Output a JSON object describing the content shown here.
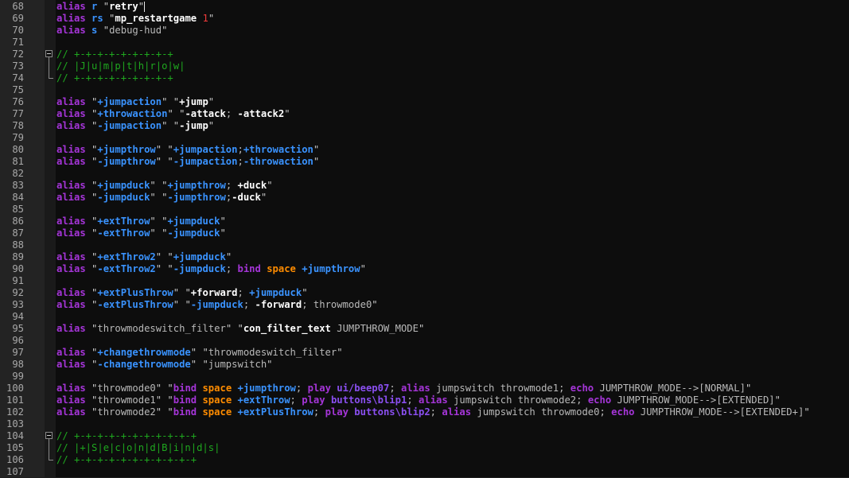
{
  "editor": {
    "colors": {
      "alias": "#a535d8",
      "plus_command": "#3a93ff",
      "comment": "#1fa81f",
      "number": "#f03a3a",
      "orange_keyword": "#ff8c00",
      "line_number": "#a8a8a8",
      "background": "#0d0d0d"
    }
  },
  "lines": [
    {
      "n": "68",
      "tokens": [
        [
          "alias",
          "t-alias"
        ],
        [
          " ",
          "t-name"
        ],
        [
          "r",
          "t-plus"
        ],
        [
          " \"",
          "t-quote"
        ],
        [
          "retry",
          "t-white"
        ],
        [
          "\"",
          "t-quote"
        ]
      ],
      "caret": true
    },
    {
      "n": "69",
      "tokens": [
        [
          "alias",
          "t-alias"
        ],
        [
          " ",
          "t-name"
        ],
        [
          "rs",
          "t-plus"
        ],
        [
          " \"",
          "t-quote"
        ],
        [
          "mp_restartgame",
          "t-white"
        ],
        [
          " ",
          "t-quote"
        ],
        [
          "1",
          "t-num"
        ],
        [
          "\"",
          "t-quote"
        ]
      ]
    },
    {
      "n": "70",
      "tokens": [
        [
          "alias",
          "t-alias"
        ],
        [
          " ",
          "t-name"
        ],
        [
          "s",
          "t-plus"
        ],
        [
          " \"",
          "t-quote"
        ],
        [
          "debug-hud",
          "t-dim"
        ],
        [
          "\"",
          "t-quote"
        ]
      ]
    },
    {
      "n": "71",
      "tokens": []
    },
    {
      "n": "72",
      "tokens": [
        [
          "// +-+-+-+-+-+-+-+-+",
          "t-comment"
        ]
      ],
      "fold": "start"
    },
    {
      "n": "73",
      "tokens": [
        [
          "// |J|u|m|p|t|h|r|o|w|",
          "t-comment"
        ]
      ]
    },
    {
      "n": "74",
      "tokens": [
        [
          "// +-+-+-+-+-+-+-+-+",
          "t-comment"
        ]
      ],
      "fold": "end"
    },
    {
      "n": "75",
      "tokens": []
    },
    {
      "n": "76",
      "tokens": [
        [
          "alias",
          "t-alias"
        ],
        [
          " \"",
          "t-quote"
        ],
        [
          "+jumpaction",
          "t-plus"
        ],
        [
          "\" \"",
          "t-quote"
        ],
        [
          "+jump",
          "t-white"
        ],
        [
          "\"",
          "t-quote"
        ]
      ]
    },
    {
      "n": "77",
      "tokens": [
        [
          "alias",
          "t-alias"
        ],
        [
          " \"",
          "t-quote"
        ],
        [
          "+throwaction",
          "t-plus"
        ],
        [
          "\" \"",
          "t-quote"
        ],
        [
          "-attack",
          "t-white"
        ],
        [
          "; ",
          "t-dim"
        ],
        [
          "-attack2",
          "t-white"
        ],
        [
          "\"",
          "t-quote"
        ]
      ]
    },
    {
      "n": "78",
      "tokens": [
        [
          "alias",
          "t-alias"
        ],
        [
          " \"",
          "t-quote"
        ],
        [
          "-jumpaction",
          "t-plus"
        ],
        [
          "\" \"",
          "t-quote"
        ],
        [
          "-jump",
          "t-white"
        ],
        [
          "\"",
          "t-quote"
        ]
      ]
    },
    {
      "n": "79",
      "tokens": []
    },
    {
      "n": "80",
      "tokens": [
        [
          "alias",
          "t-alias"
        ],
        [
          " \"",
          "t-quote"
        ],
        [
          "+jumpthrow",
          "t-plus"
        ],
        [
          "\" \"",
          "t-quote"
        ],
        [
          "+jumpaction",
          "t-plus"
        ],
        [
          ";",
          "t-dim"
        ],
        [
          "+throwaction",
          "t-plus"
        ],
        [
          "\"",
          "t-quote"
        ]
      ]
    },
    {
      "n": "81",
      "tokens": [
        [
          "alias",
          "t-alias"
        ],
        [
          " \"",
          "t-quote"
        ],
        [
          "-jumpthrow",
          "t-plus"
        ],
        [
          "\" \"",
          "t-quote"
        ],
        [
          "-jumpaction",
          "t-plus"
        ],
        [
          ";",
          "t-dim"
        ],
        [
          "-throwaction",
          "t-plus"
        ],
        [
          "\"",
          "t-quote"
        ]
      ]
    },
    {
      "n": "82",
      "tokens": []
    },
    {
      "n": "83",
      "tokens": [
        [
          "alias",
          "t-alias"
        ],
        [
          " \"",
          "t-quote"
        ],
        [
          "+jumpduck",
          "t-plus"
        ],
        [
          "\" \"",
          "t-quote"
        ],
        [
          "+jumpthrow",
          "t-plus"
        ],
        [
          "; ",
          "t-dim"
        ],
        [
          "+duck",
          "t-white"
        ],
        [
          "\"",
          "t-quote"
        ]
      ]
    },
    {
      "n": "84",
      "tokens": [
        [
          "alias",
          "t-alias"
        ],
        [
          " \"",
          "t-quote"
        ],
        [
          "-jumpduck",
          "t-plus"
        ],
        [
          "\" \"",
          "t-quote"
        ],
        [
          "-jumpthrow",
          "t-plus"
        ],
        [
          ";",
          "t-dim"
        ],
        [
          "-duck",
          "t-white"
        ],
        [
          "\"",
          "t-quote"
        ]
      ]
    },
    {
      "n": "85",
      "tokens": []
    },
    {
      "n": "86",
      "tokens": [
        [
          "alias",
          "t-alias"
        ],
        [
          " \"",
          "t-quote"
        ],
        [
          "+extThrow",
          "t-plus"
        ],
        [
          "\" \"",
          "t-quote"
        ],
        [
          "+jumpduck",
          "t-plus"
        ],
        [
          "\"",
          "t-quote"
        ]
      ]
    },
    {
      "n": "87",
      "tokens": [
        [
          "alias",
          "t-alias"
        ],
        [
          " \"",
          "t-quote"
        ],
        [
          "-extThrow",
          "t-plus"
        ],
        [
          "\" \"",
          "t-quote"
        ],
        [
          "-jumpduck",
          "t-plus"
        ],
        [
          "\"",
          "t-quote"
        ]
      ]
    },
    {
      "n": "88",
      "tokens": []
    },
    {
      "n": "89",
      "tokens": [
        [
          "alias",
          "t-alias"
        ],
        [
          " \"",
          "t-quote"
        ],
        [
          "+extThrow2",
          "t-plus"
        ],
        [
          "\" \"",
          "t-quote"
        ],
        [
          "+jumpduck",
          "t-plus"
        ],
        [
          "\"",
          "t-quote"
        ]
      ]
    },
    {
      "n": "90",
      "tokens": [
        [
          "alias",
          "t-alias"
        ],
        [
          " \"",
          "t-quote"
        ],
        [
          "-extThrow2",
          "t-plus"
        ],
        [
          "\" \"",
          "t-quote"
        ],
        [
          "-jumpduck",
          "t-plus"
        ],
        [
          "; ",
          "t-dim"
        ],
        [
          "bind",
          "t-bind"
        ],
        [
          " ",
          "t-dim"
        ],
        [
          "space",
          "t-orange"
        ],
        [
          " ",
          "t-dim"
        ],
        [
          "+jumpthrow",
          "t-plus"
        ],
        [
          "\"",
          "t-quote"
        ]
      ]
    },
    {
      "n": "91",
      "tokens": []
    },
    {
      "n": "92",
      "tokens": [
        [
          "alias",
          "t-alias"
        ],
        [
          " \"",
          "t-quote"
        ],
        [
          "+extPlusThrow",
          "t-plus"
        ],
        [
          "\" \"",
          "t-quote"
        ],
        [
          "+forward",
          "t-white"
        ],
        [
          "; ",
          "t-dim"
        ],
        [
          "+jumpduck",
          "t-plus"
        ],
        [
          "\"",
          "t-quote"
        ]
      ]
    },
    {
      "n": "93",
      "tokens": [
        [
          "alias",
          "t-alias"
        ],
        [
          " \"",
          "t-quote"
        ],
        [
          "-extPlusThrow",
          "t-plus"
        ],
        [
          "\" \"",
          "t-quote"
        ],
        [
          "-jumpduck",
          "t-plus"
        ],
        [
          "; ",
          "t-dim"
        ],
        [
          "-forward",
          "t-white"
        ],
        [
          "; ",
          "t-dim"
        ],
        [
          "throwmode0",
          "t-dim"
        ],
        [
          "\"",
          "t-quote"
        ]
      ]
    },
    {
      "n": "94",
      "tokens": []
    },
    {
      "n": "95",
      "tokens": [
        [
          "alias",
          "t-alias"
        ],
        [
          " \"",
          "t-quote"
        ],
        [
          "throwmodeswitch_filter",
          "t-dim"
        ],
        [
          "\" \"",
          "t-quote"
        ],
        [
          "con_filter_text",
          "t-white"
        ],
        [
          " ",
          "t-dim"
        ],
        [
          "JUMPTHROW_MODE",
          "t-dim"
        ],
        [
          "\"",
          "t-quote"
        ]
      ]
    },
    {
      "n": "96",
      "tokens": []
    },
    {
      "n": "97",
      "tokens": [
        [
          "alias",
          "t-alias"
        ],
        [
          " \"",
          "t-quote"
        ],
        [
          "+changethrowmode",
          "t-plus"
        ],
        [
          "\" \"",
          "t-quote"
        ],
        [
          "throwmodeswitch_filter",
          "t-dim"
        ],
        [
          "\"",
          "t-quote"
        ]
      ]
    },
    {
      "n": "98",
      "tokens": [
        [
          "alias",
          "t-alias"
        ],
        [
          " \"",
          "t-quote"
        ],
        [
          "-changethrowmode",
          "t-plus"
        ],
        [
          "\" \"",
          "t-quote"
        ],
        [
          "jumpswitch",
          "t-dim"
        ],
        [
          "\"",
          "t-quote"
        ]
      ]
    },
    {
      "n": "99",
      "tokens": []
    },
    {
      "n": "100",
      "tokens": [
        [
          "alias",
          "t-alias"
        ],
        [
          " \"",
          "t-quote"
        ],
        [
          "throwmode0",
          "t-dim"
        ],
        [
          "\" \"",
          "t-quote"
        ],
        [
          "bind",
          "t-bind"
        ],
        [
          " ",
          "t-dim"
        ],
        [
          "space",
          "t-orange"
        ],
        [
          " ",
          "t-dim"
        ],
        [
          "+jumpthrow",
          "t-plus"
        ],
        [
          "; ",
          "t-dim"
        ],
        [
          "play",
          "t-play"
        ],
        [
          " ",
          "t-dim"
        ],
        [
          "ui/beep07",
          "t-path"
        ],
        [
          "; ",
          "t-dim"
        ],
        [
          "alias",
          "t-alias"
        ],
        [
          " jumpswitch throwmode1; ",
          "t-dim"
        ],
        [
          "echo",
          "t-echo"
        ],
        [
          " JUMPTHROW_MODE-->[NORMAL]",
          "t-dim"
        ],
        [
          "\"",
          "t-quote"
        ]
      ]
    },
    {
      "n": "101",
      "tokens": [
        [
          "alias",
          "t-alias"
        ],
        [
          " \"",
          "t-quote"
        ],
        [
          "throwmode1",
          "t-dim"
        ],
        [
          "\" \"",
          "t-quote"
        ],
        [
          "bind",
          "t-bind"
        ],
        [
          " ",
          "t-dim"
        ],
        [
          "space",
          "t-orange"
        ],
        [
          " ",
          "t-dim"
        ],
        [
          "+extThrow",
          "t-plus"
        ],
        [
          "; ",
          "t-dim"
        ],
        [
          "play",
          "t-play"
        ],
        [
          " ",
          "t-dim"
        ],
        [
          "buttons\\blip1",
          "t-path"
        ],
        [
          "; ",
          "t-dim"
        ],
        [
          "alias",
          "t-alias"
        ],
        [
          " jumpswitch throwmode2; ",
          "t-dim"
        ],
        [
          "echo",
          "t-echo"
        ],
        [
          " JUMPTHROW_MODE-->[EXTENDED]",
          "t-dim"
        ],
        [
          "\"",
          "t-quote"
        ]
      ]
    },
    {
      "n": "102",
      "tokens": [
        [
          "alias",
          "t-alias"
        ],
        [
          " \"",
          "t-quote"
        ],
        [
          "throwmode2",
          "t-dim"
        ],
        [
          "\" \"",
          "t-quote"
        ],
        [
          "bind",
          "t-bind"
        ],
        [
          " ",
          "t-dim"
        ],
        [
          "space",
          "t-orange"
        ],
        [
          " ",
          "t-dim"
        ],
        [
          "+extPlusThrow",
          "t-plus"
        ],
        [
          "; ",
          "t-dim"
        ],
        [
          "play",
          "t-play"
        ],
        [
          " ",
          "t-dim"
        ],
        [
          "buttons\\blip2",
          "t-path"
        ],
        [
          "; ",
          "t-dim"
        ],
        [
          "alias",
          "t-alias"
        ],
        [
          " jumpswitch throwmode0; ",
          "t-dim"
        ],
        [
          "echo",
          "t-echo"
        ],
        [
          " JUMPTHROW_MODE-->[EXTENDED+]",
          "t-dim"
        ],
        [
          "\"",
          "t-quote"
        ]
      ]
    },
    {
      "n": "103",
      "tokens": []
    },
    {
      "n": "104",
      "tokens": [
        [
          "// +-+-+-+-+-+-+-+-+-+-+",
          "t-comment"
        ]
      ],
      "fold": "start"
    },
    {
      "n": "105",
      "tokens": [
        [
          "// |+|S|e|c|o|n|d|B|i|n|d|s|",
          "t-comment"
        ]
      ]
    },
    {
      "n": "106",
      "tokens": [
        [
          "// +-+-+-+-+-+-+-+-+-+-+",
          "t-comment"
        ]
      ],
      "fold": "end"
    },
    {
      "n": "107",
      "tokens": []
    }
  ]
}
